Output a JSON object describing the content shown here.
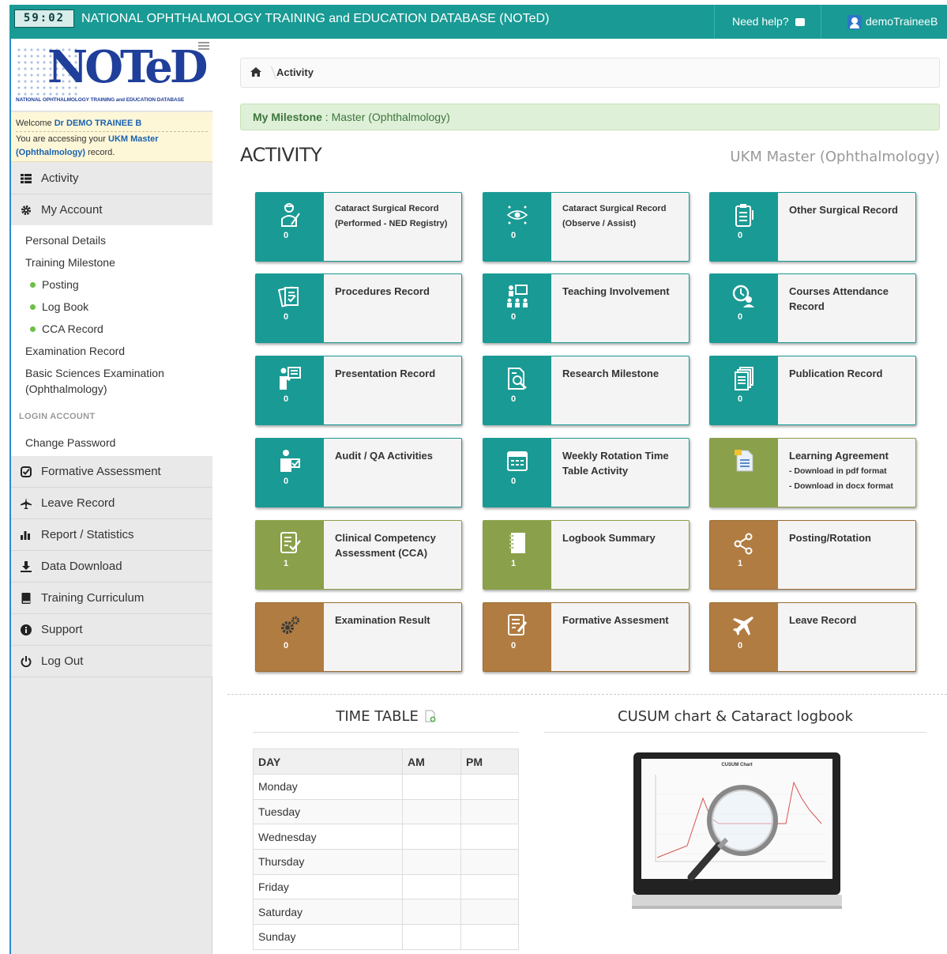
{
  "topbar": {
    "timer": "59:02",
    "title": "NATIONAL OPHTHALMOLOGY TRAINING and EDUCATION DATABASE (NOTeD)",
    "help": "Need help?",
    "user": "demoTraineeB"
  },
  "logo": {
    "wordmark": "NOTeD",
    "tagline": "NATIONAL OPHTHALMOLOGY TRAINING and EDUCATION DATABASE"
  },
  "welcome": {
    "prefix": "Welcome",
    "name": "Dr DEMO TRAINEE B",
    "access_prefix": "You are accessing your",
    "record_name": "UKM Master (Ophthalmology)",
    "access_suffix": "record."
  },
  "sidebar": {
    "activity": "Activity",
    "my_account": "My Account",
    "sub": {
      "personal_details": "Personal Details",
      "training_milestone": "Training Milestone",
      "posting": "Posting",
      "log_book": "Log Book",
      "cca_record": "CCA Record",
      "examination_record": "Examination Record",
      "basic_sciences_1": "Basic Sciences Examination",
      "basic_sciences_2": "(Ophthalmology)",
      "login_account": "LOGIN ACCOUNT",
      "change_password": "Change Password"
    },
    "formative": "Formative Assessment",
    "leave": "Leave Record",
    "report": "Report / Statistics",
    "download": "Data Download",
    "curriculum": "Training Curriculum",
    "support": "Support",
    "logout": "Log Out"
  },
  "breadcrumb": {
    "current": "Activity"
  },
  "milestone": {
    "label": "My Milestone",
    "value": " : Master (Ophthalmology)"
  },
  "page": {
    "title": "ACTIVITY",
    "subtitle": "UKM Master (Ophthalmology)"
  },
  "tiles": {
    "cataract_performed": {
      "line1": "Cataract Surgical Record",
      "line2": "(Performed - NED Registry)",
      "count": "0"
    },
    "cataract_observe": {
      "line1": "Cataract Surgical Record",
      "line2": "(Observe / Assist)",
      "count": "0"
    },
    "other_surgical": {
      "label": "Other Surgical Record",
      "count": "0"
    },
    "procedures": {
      "label": "Procedures Record",
      "count": "0"
    },
    "teaching": {
      "label": "Teaching Involvement",
      "count": "0"
    },
    "courses": {
      "line1": "Courses Attendance",
      "line2": "Record",
      "count": "0"
    },
    "presentation": {
      "label": "Presentation Record",
      "count": "0"
    },
    "research": {
      "label": "Research Milestone",
      "count": "0"
    },
    "publication": {
      "label": "Publication Record",
      "count": "0"
    },
    "audit": {
      "label": "Audit / QA Activities",
      "count": "0"
    },
    "weekly": {
      "line1": "Weekly Rotation Time",
      "line2": "Table Activity",
      "count": "0"
    },
    "learning": {
      "label": "Learning Agreement",
      "pdf": "- Download in pdf format",
      "docx": "- Download in docx format"
    },
    "cca": {
      "line1": "Clinical Competency",
      "line2": "Assessment (CCA)",
      "count": "1"
    },
    "logbook": {
      "label": "Logbook Summary",
      "count": "1"
    },
    "posting": {
      "label": "Posting/Rotation",
      "count": "1"
    },
    "exam": {
      "label": "Examination Result",
      "count": "0"
    },
    "formative": {
      "label": "Formative Assesment",
      "count": "0"
    },
    "leave": {
      "label": "Leave Record",
      "count": "0"
    }
  },
  "timetable": {
    "title": "TIME TABLE",
    "headers": [
      "DAY",
      "AM",
      "PM"
    ],
    "days": [
      "Monday",
      "Tuesday",
      "Wednesday",
      "Thursday",
      "Friday",
      "Saturday",
      "Sunday"
    ]
  },
  "cusum": {
    "title": "CUSUM chart & Cataract logbook",
    "screen_title": "CUSUM Chart"
  },
  "colors": {
    "teal": "#1a9a94",
    "olive": "#8aa04a",
    "brown": "#b07c42",
    "sidebar_border": "#2b8bd0"
  }
}
